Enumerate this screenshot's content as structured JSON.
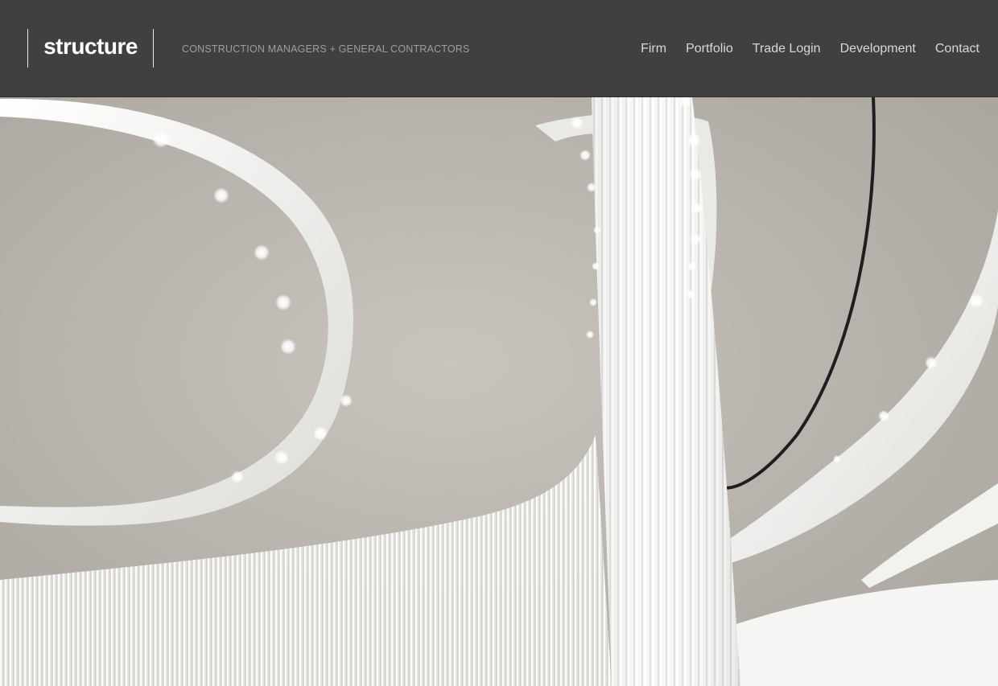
{
  "brand": {
    "logo": "structure",
    "tagline": "CONSTRUCTION MANAGERS + GENERAL CONTRACTORS"
  },
  "nav": {
    "items": [
      {
        "label": "Firm"
      },
      {
        "label": "Portfolio"
      },
      {
        "label": "Trade Login"
      },
      {
        "label": "Development"
      },
      {
        "label": "Contact"
      }
    ]
  },
  "hero": {
    "image_subject": "curved white architectural ceiling with recessed downlights and a fluted column"
  },
  "colors": {
    "header_bg": "#404040",
    "nav_text": "#d8d8d8",
    "tagline_text": "#9e9e9e",
    "ceiling": "#bdb8b1"
  }
}
